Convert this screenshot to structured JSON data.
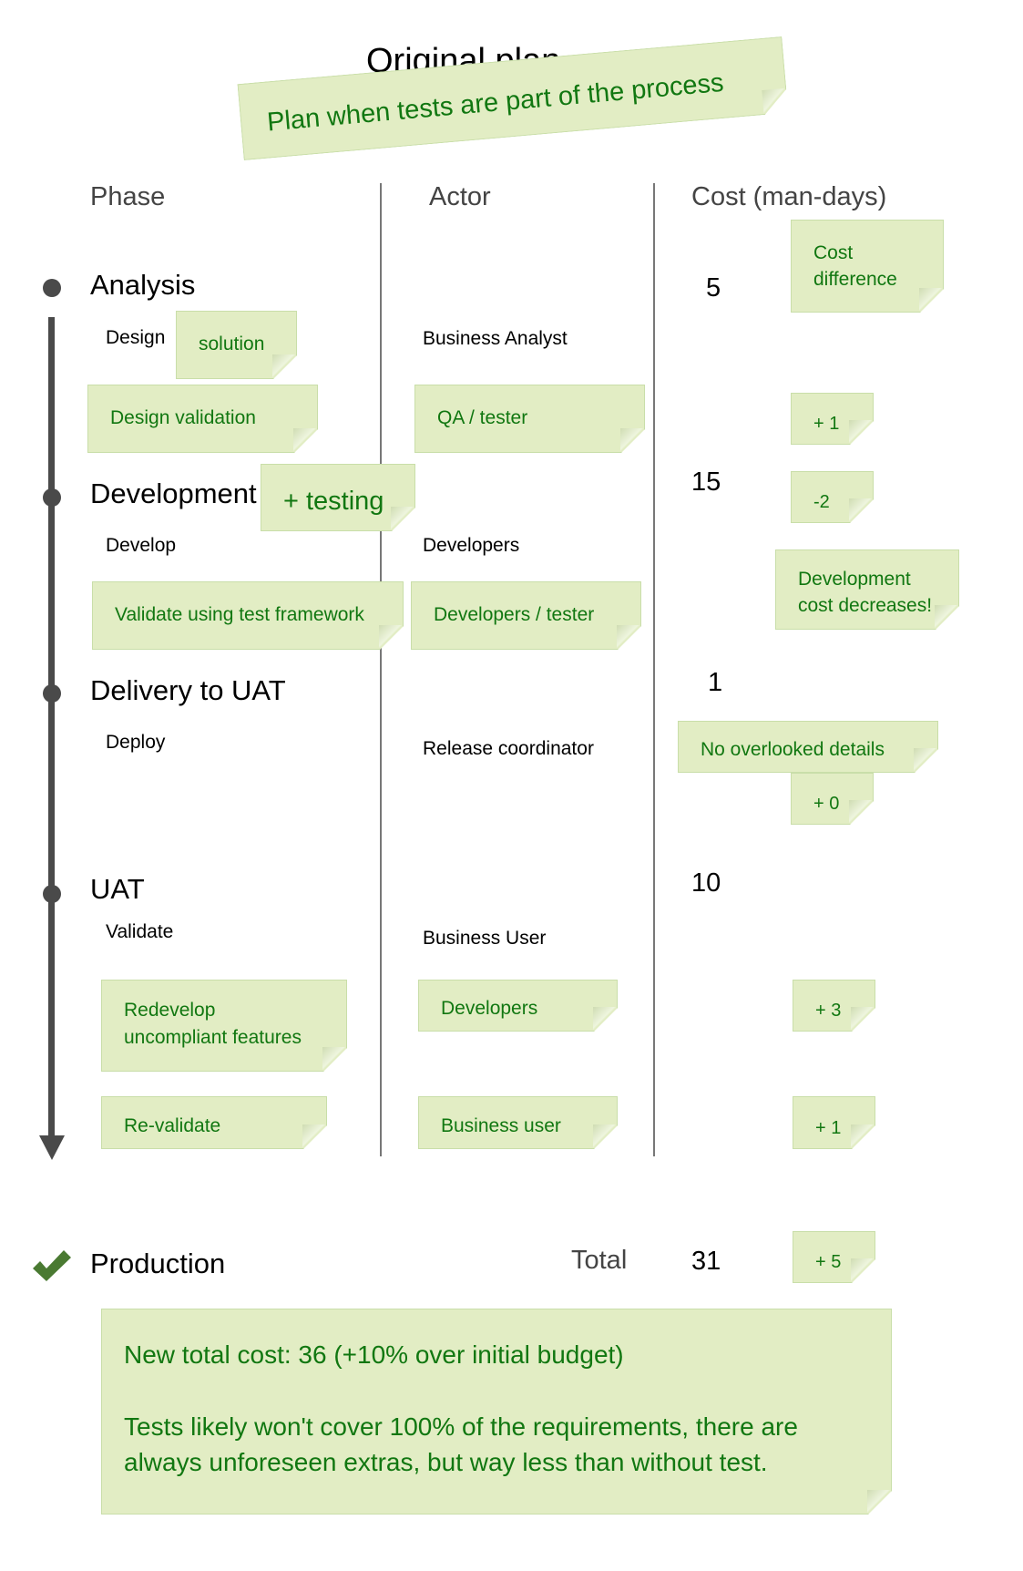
{
  "title": "Original plan",
  "title_note": "Plan when tests are part of the process",
  "headers": {
    "phase": "Phase",
    "actor": "Actor",
    "cost": "Cost (man-days)"
  },
  "phases": [
    {
      "name": "Analysis",
      "step": "Design",
      "actor": "Business Analyst",
      "cost": "5"
    },
    {
      "name": "Development",
      "step": "Develop",
      "actor": "Developers",
      "cost": "15"
    },
    {
      "name": "Delivery to UAT",
      "step": "Deploy",
      "actor": "Release coordinator",
      "cost": "1"
    },
    {
      "name": "UAT",
      "step": "Validate",
      "actor": "Business User",
      "cost": "10"
    }
  ],
  "final": {
    "name": "Production",
    "total_label": "Total",
    "total_value": "31"
  },
  "notes": {
    "cost_difference": "Cost difference",
    "solution": "solution",
    "design_validation": "Design validation",
    "qa_tester": "QA / tester",
    "analysis_delta": "+ 1",
    "plus_testing": "+ testing",
    "development_delta": "-2",
    "development_decrease_line1": "Development",
    "development_decrease_line2": "cost decreases!",
    "validate_framework": "Validate using test framework",
    "developers_tester": "Developers / tester",
    "no_overlooked": "No overlooked details",
    "delivery_delta": "+ 0",
    "redevelop_line1": "Redevelop",
    "redevelop_line2": "uncompliant features",
    "developers": "Developers",
    "redevelop_delta": "+ 3",
    "revalidate": "Re-validate",
    "business_user": "Business user",
    "revalidate_delta": "+ 1",
    "total_delta": "+ 5",
    "summary_line1": "New total cost: 36 (+10% over initial budget)",
    "summary_line2": "Tests likely won't cover 100% of the requirements, there are always unforeseen extras, but way less than without test."
  },
  "colors": {
    "note_fill": "#e2edc4",
    "note_text": "#117711",
    "timeline": "#4a4a4a",
    "check": "#4a7a32"
  }
}
